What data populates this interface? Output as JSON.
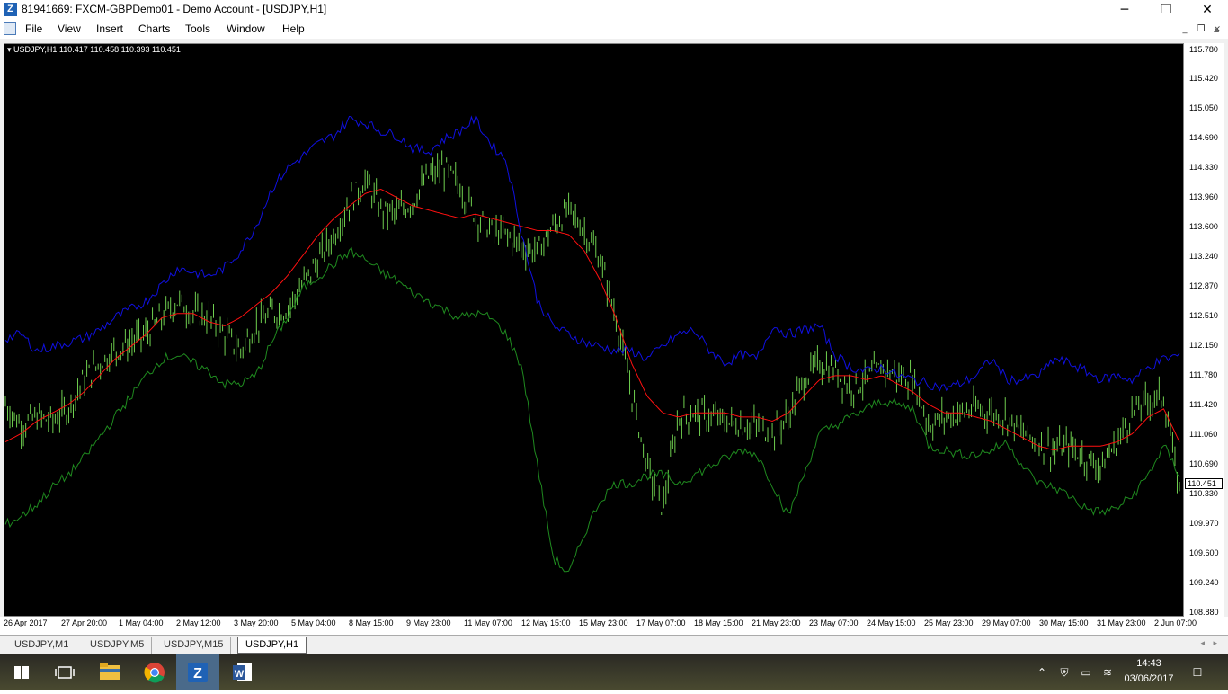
{
  "window": {
    "title": "81941669: FXCM-GBPDemo01 - Demo Account - [USDJPY,H1]",
    "minimize_glyph": "─",
    "restore_glyph": "❐",
    "close_glyph": "✕"
  },
  "menu": {
    "items": [
      "File",
      "View",
      "Insert",
      "Charts",
      "Tools",
      "Window",
      "Help"
    ]
  },
  "chart_info": {
    "label": "USDJPY,H1  110.417 110.458 110.393 110.451"
  },
  "price_axis": {
    "labels": [
      "115.780",
      "115.420",
      "115.050",
      "114.690",
      "114.330",
      "113.960",
      "113.600",
      "113.240",
      "112.870",
      "112.510",
      "112.150",
      "111.780",
      "111.420",
      "111.060",
      "110.690",
      "110.330",
      "109.970",
      "109.600",
      "109.240",
      "108.880"
    ],
    "current_price": "110.451"
  },
  "time_axis": {
    "labels": [
      "26 Apr 2017",
      "27 Apr 20:00",
      "1 May 04:00",
      "2 May 12:00",
      "3 May 20:00",
      "5 May 04:00",
      "8 May 15:00",
      "9 May 23:00",
      "11 May 07:00",
      "12 May 15:00",
      "15 May 23:00",
      "17 May 07:00",
      "18 May 15:00",
      "21 May 23:00",
      "23 May 07:00",
      "24 May 15:00",
      "25 May 23:00",
      "29 May 07:00",
      "30 May 15:00",
      "31 May 23:00",
      "2 Jun 07:00"
    ]
  },
  "tabs": [
    "USDJPY,M1",
    "USDJPY,M5",
    "USDJPY,M15",
    "USDJPY,H1"
  ],
  "active_tab": "USDJPY,H1",
  "taskbar": {
    "time": "14:43",
    "date": "03/06/2017"
  },
  "colors": {
    "chart_bg": "#000000",
    "bars": "#6fcf4f",
    "upper_band": "#1010e0",
    "moving_average": "#ff1010",
    "lower_band": "#1f8a1f"
  },
  "chart_data": {
    "type": "line",
    "symbol": "USDJPY",
    "timeframe": "H1",
    "ylim": [
      108.88,
      115.78
    ],
    "series": [
      {
        "style": "ohlc-bars",
        "values": [
          111.45,
          111.2,
          111.3,
          111.25,
          111.4,
          111.75,
          111.95,
          112.1,
          112.2,
          112.3,
          112.5,
          112.7,
          112.55,
          112.5,
          112.3,
          112.1,
          112.4,
          112.55,
          112.6,
          112.9,
          113.2,
          113.5,
          113.9,
          114.15,
          113.8,
          113.75,
          113.9,
          114.2,
          114.3,
          114.1,
          113.75,
          113.55,
          113.5,
          113.35,
          113.3,
          113.6,
          113.8,
          113.55,
          113.2,
          112.5,
          111.6,
          110.7,
          110.2,
          111.3,
          111.35,
          111.3,
          111.25,
          111.2,
          111.2,
          111.1,
          111.3,
          111.75,
          111.95,
          111.85,
          111.65,
          111.75,
          111.9,
          111.8,
          111.75,
          111.2,
          111.3,
          111.35,
          111.4,
          111.35,
          111.3,
          111.1,
          111.0,
          110.9,
          110.95,
          110.8,
          110.7,
          111.0,
          111.35,
          111.5,
          111.55,
          110.4
        ]
      },
      {
        "style": "line",
        "values": [
          111.0,
          111.1,
          111.25,
          111.35,
          111.45,
          111.6,
          111.8,
          112.0,
          112.15,
          112.3,
          112.5,
          112.55,
          112.55,
          112.45,
          112.4,
          112.5,
          112.65,
          112.8,
          113.0,
          113.25,
          113.5,
          113.7,
          113.85,
          114.0,
          114.05,
          113.95,
          113.85,
          113.8,
          113.75,
          113.7,
          113.75,
          113.7,
          113.65,
          113.6,
          113.55,
          113.55,
          113.5,
          113.3,
          112.95,
          112.5,
          111.95,
          111.55,
          111.35,
          111.3,
          111.35,
          111.35,
          111.35,
          111.3,
          111.3,
          111.25,
          111.35,
          111.55,
          111.75,
          111.8,
          111.8,
          111.75,
          111.8,
          111.7,
          111.6,
          111.45,
          111.35,
          111.35,
          111.3,
          111.25,
          111.15,
          111.05,
          110.95,
          110.9,
          110.95,
          110.95,
          110.95,
          111.0,
          111.1,
          111.3,
          111.4,
          111.0
        ]
      },
      {
        "style": "line",
        "values": [
          112.25,
          112.3,
          112.1,
          112.15,
          112.2,
          112.25,
          112.35,
          112.5,
          112.6,
          112.7,
          112.9,
          113.1,
          113.05,
          113.0,
          113.1,
          113.3,
          113.6,
          114.05,
          114.3,
          114.45,
          114.6,
          114.7,
          114.9,
          114.85,
          114.75,
          114.7,
          114.55,
          114.5,
          114.65,
          114.75,
          114.9,
          114.6,
          114.4,
          113.5,
          112.7,
          112.4,
          112.3,
          112.2,
          112.15,
          112.1,
          112.1,
          112.0,
          112.15,
          112.3,
          112.35,
          112.1,
          111.95,
          112.05,
          112.0,
          112.4,
          112.3,
          112.35,
          112.4,
          112.05,
          111.9,
          111.85,
          111.9,
          111.8,
          111.75,
          111.7,
          111.65,
          111.7,
          111.8,
          112.0,
          111.75,
          111.75,
          111.8,
          112.0,
          111.95,
          111.85,
          111.75,
          111.8,
          111.75,
          111.9,
          112.0,
          112.05
        ]
      },
      {
        "style": "line",
        "values": [
          110.0,
          110.1,
          110.25,
          110.45,
          110.6,
          110.8,
          111.05,
          111.3,
          111.55,
          111.8,
          112.0,
          112.05,
          111.95,
          111.85,
          111.7,
          111.7,
          111.8,
          112.2,
          112.5,
          112.85,
          113.0,
          113.15,
          113.3,
          113.2,
          113.05,
          112.95,
          112.8,
          112.7,
          112.6,
          112.5,
          112.55,
          112.5,
          112.3,
          111.9,
          110.7,
          109.6,
          109.4,
          109.9,
          110.3,
          110.5,
          110.5,
          110.6,
          110.6,
          110.5,
          110.6,
          110.7,
          110.8,
          110.9,
          110.85,
          110.5,
          110.1,
          110.6,
          111.1,
          111.2,
          111.3,
          111.4,
          111.5,
          111.45,
          111.4,
          110.95,
          110.9,
          110.85,
          110.85,
          110.9,
          111.0,
          110.7,
          110.5,
          110.45,
          110.35,
          110.2,
          110.15,
          110.2,
          110.35,
          110.6,
          110.95,
          110.6
        ]
      }
    ]
  }
}
